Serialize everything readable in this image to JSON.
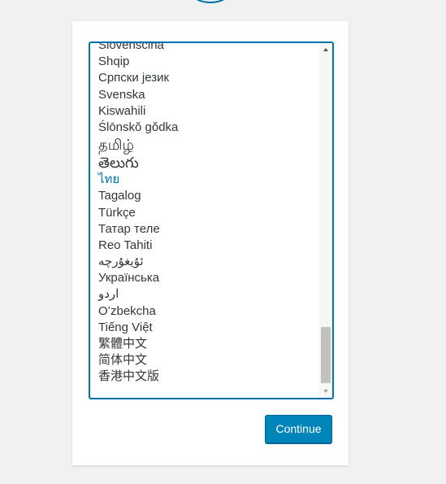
{
  "logo": {
    "icon": "wordpress-logo-icon",
    "color": "#0073aa"
  },
  "language_list": {
    "selected": "ไทย",
    "items": [
      "Slovenščina",
      "Shqip",
      "Српски језик",
      "Svenska",
      "Kiswahili",
      "Ślōnskŏ gŏdka",
      "தமிழ்",
      "తెలుగు",
      "ไทย",
      "Tagalog",
      "Türkçe",
      "Татар теле",
      "Reo Tahiti",
      "ئۇيغۇرچە",
      "Українська",
      "اردو",
      "Oʻzbekcha",
      "Tiếng Việt",
      "繁體中文",
      "简体中文",
      "香港中文版"
    ]
  },
  "continue_button": {
    "label": "Continue"
  },
  "colors": {
    "accent": "#0073aa",
    "button": "#0085ba",
    "background": "#f1f1f1"
  }
}
